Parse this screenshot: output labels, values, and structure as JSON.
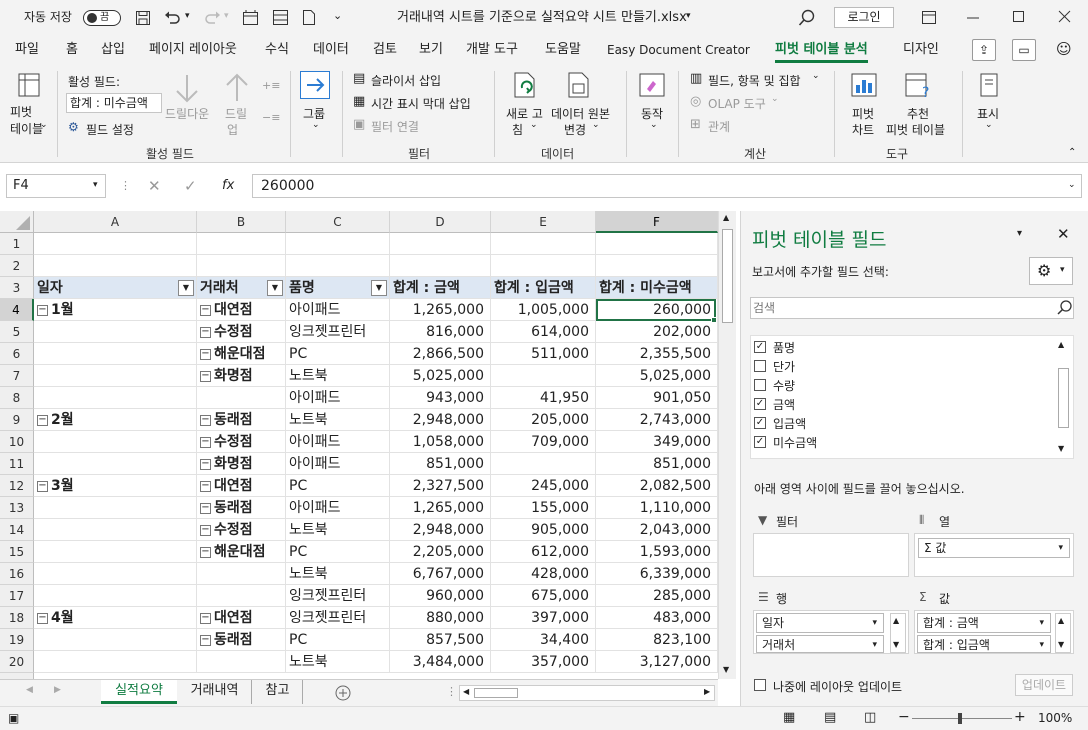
{
  "titlebar": {
    "autosave_label": "자동 저장",
    "autosave_state": "끔",
    "filename": "거래내역 시트를 기준으로 실적요약 시트 만들기.xlsx",
    "login_label": "로그인"
  },
  "menu": {
    "tabs": [
      "파일",
      "홈",
      "삽입",
      "페이지 레이아웃",
      "수식",
      "데이터",
      "검토",
      "보기",
      "개발 도구",
      "도움말",
      "Easy Document Creator",
      "피벗 테이블 분석",
      "디자인"
    ],
    "active_tab": "피벗 테이블 분석"
  },
  "ribbon": {
    "pivot_table_label1": "피벗",
    "pivot_table_label2": "테이블",
    "active_field_label": "활성 필드:",
    "active_field_value": "합계 : 미수금액",
    "field_settings": "필드 설정",
    "drill_down": "드릴다운",
    "drill_up1": "드릴",
    "drill_up2": "업",
    "group_active_field": "활성 필드",
    "group": "그룹",
    "insert_slicer": "슬라이서 삽입",
    "insert_timeline": "시간 표시 막대 삽입",
    "filter_connections": "필터 연결",
    "group_filter": "필터",
    "refresh1": "새로 고",
    "refresh2": "침",
    "change_source1": "데이터 원본",
    "change_source2": "변경",
    "group_data": "데이터",
    "actions": "동작",
    "fields_items_sets": "필드, 항목 및 집합",
    "olap_tools": "OLAP 도구",
    "relationships": "관계",
    "group_calc": "계산",
    "pivot_chart1": "피벗",
    "pivot_chart2": "차트",
    "recommended1": "추천",
    "recommended2": "피벗 테이블",
    "group_tools": "도구",
    "show": "표시"
  },
  "formula_bar": {
    "name_box": "F4",
    "fx": "fx",
    "value": "260000"
  },
  "sheet": {
    "columns": [
      "A",
      "B",
      "C",
      "D",
      "E",
      "F"
    ],
    "selected_column": "F",
    "selected_row": "4",
    "rows": [
      {
        "n": "1",
        "a": "",
        "b": "",
        "c": "",
        "d": "",
        "e": "",
        "f": ""
      },
      {
        "n": "2",
        "a": "",
        "b": "",
        "c": "",
        "d": "",
        "e": "",
        "f": ""
      },
      {
        "n": "3",
        "a": "일자",
        "b": "거래처",
        "c": "품명",
        "d": "합계 : 금액",
        "e": "합계 : 입금액",
        "f": "합계 : 미수금액"
      },
      {
        "n": "4",
        "a": "1월",
        "b": "대연점",
        "c": "아이패드",
        "d": "1,265,000",
        "e": "1,005,000",
        "f": "260,000"
      },
      {
        "n": "5",
        "a": "",
        "b": "수정점",
        "c": "잉크젯프린터",
        "d": "816,000",
        "e": "614,000",
        "f": "202,000"
      },
      {
        "n": "6",
        "a": "",
        "b": "해운대점",
        "c": "PC",
        "d": "2,866,500",
        "e": "511,000",
        "f": "2,355,500"
      },
      {
        "n": "7",
        "a": "",
        "b": "화명점",
        "c": "노트북",
        "d": "5,025,000",
        "e": "",
        "f": "5,025,000"
      },
      {
        "n": "8",
        "a": "",
        "b": "",
        "c": "아이패드",
        "d": "943,000",
        "e": "41,950",
        "f": "901,050"
      },
      {
        "n": "9",
        "a": "2월",
        "b": "동래점",
        "c": "노트북",
        "d": "2,948,000",
        "e": "205,000",
        "f": "2,743,000"
      },
      {
        "n": "10",
        "a": "",
        "b": "수정점",
        "c": "아이패드",
        "d": "1,058,000",
        "e": "709,000",
        "f": "349,000"
      },
      {
        "n": "11",
        "a": "",
        "b": "화명점",
        "c": "아이패드",
        "d": "851,000",
        "e": "",
        "f": "851,000"
      },
      {
        "n": "12",
        "a": "3월",
        "b": "대연점",
        "c": "PC",
        "d": "2,327,500",
        "e": "245,000",
        "f": "2,082,500"
      },
      {
        "n": "13",
        "a": "",
        "b": "동래점",
        "c": "아이패드",
        "d": "1,265,000",
        "e": "155,000",
        "f": "1,110,000"
      },
      {
        "n": "14",
        "a": "",
        "b": "수정점",
        "c": "노트북",
        "d": "2,948,000",
        "e": "905,000",
        "f": "2,043,000"
      },
      {
        "n": "15",
        "a": "",
        "b": "해운대점",
        "c": "PC",
        "d": "2,205,000",
        "e": "612,000",
        "f": "1,593,000"
      },
      {
        "n": "16",
        "a": "",
        "b": "",
        "c": "노트북",
        "d": "6,767,000",
        "e": "428,000",
        "f": "6,339,000"
      },
      {
        "n": "17",
        "a": "",
        "b": "",
        "c": "잉크젯프린터",
        "d": "960,000",
        "e": "675,000",
        "f": "285,000"
      },
      {
        "n": "18",
        "a": "4월",
        "b": "대연점",
        "c": "잉크젯프린터",
        "d": "880,000",
        "e": "397,000",
        "f": "483,000"
      },
      {
        "n": "19",
        "a": "",
        "b": "동래점",
        "c": "PC",
        "d": "857,500",
        "e": "34,400",
        "f": "823,100"
      },
      {
        "n": "20",
        "a": "",
        "b": "",
        "c": "노트북",
        "d": "3,484,000",
        "e": "357,000",
        "f": "3,127,000"
      }
    ]
  },
  "sheet_tabs": {
    "tabs": [
      "실적요약",
      "거래내역",
      "참고"
    ],
    "active": "실적요약"
  },
  "pivot_pane": {
    "title": "피벗 테이블 필드",
    "subtitle": "보고서에 추가할 필드 선택:",
    "search_placeholder": "검색",
    "fields": [
      {
        "label": "품명",
        "checked": true
      },
      {
        "label": "단가",
        "checked": false
      },
      {
        "label": "수량",
        "checked": false
      },
      {
        "label": "금액",
        "checked": true
      },
      {
        "label": "입금액",
        "checked": true
      },
      {
        "label": "미수금액",
        "checked": true
      }
    ],
    "drag_hint": "아래 영역 사이에 필드를 끌어 놓으십시오.",
    "filter_label": "필터",
    "columns_label": "열",
    "columns_value": "Σ 값",
    "rows_label": "행",
    "rows_values": [
      "일자",
      "거래처"
    ],
    "values_label": "값",
    "values_values": [
      "합계 : 금액",
      "합계 : 입금액"
    ],
    "defer_label": "나중에 레이아웃 업데이트",
    "update_button": "업데이트"
  },
  "statusbar": {
    "zoom": "100%"
  },
  "colors": {
    "accent": "#107c41",
    "header_row_fill": "#dde7f3",
    "selection": "#217346"
  }
}
